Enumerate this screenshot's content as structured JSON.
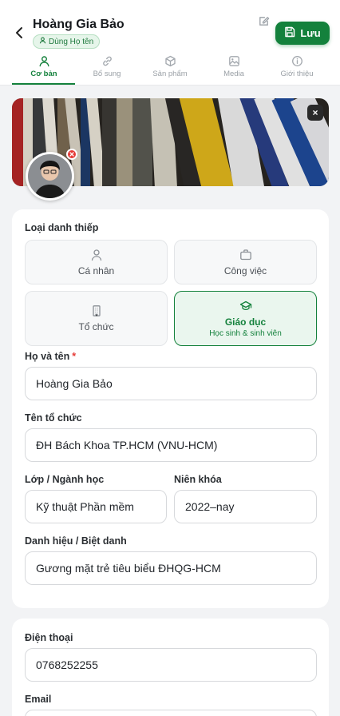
{
  "header": {
    "name": "Hoàng Gia Bảo",
    "name_chip": "Dùng Họ tên",
    "save_label": "Lưu"
  },
  "tabs": [
    {
      "label": "Cơ bản",
      "icon": "user-icon",
      "active": true
    },
    {
      "label": "Bổ sung",
      "icon": "link-icon",
      "active": false
    },
    {
      "label": "Sản phẩm",
      "icon": "box-icon",
      "active": false
    },
    {
      "label": "Media",
      "icon": "image-icon",
      "active": false
    },
    {
      "label": "Giới thiệu",
      "icon": "info-icon",
      "active": false
    }
  ],
  "cover": {
    "close_label": "×"
  },
  "card_type": {
    "title": "Loại danh thiếp",
    "options": [
      {
        "label": "Cá nhân",
        "icon": "person-icon"
      },
      {
        "label": "Công việc",
        "icon": "briefcase-icon"
      },
      {
        "label": "Tổ chức",
        "icon": "building-icon"
      },
      {
        "label": "Giáo dục",
        "sub": "Học sinh & sinh viên",
        "icon": "graduation-cap-icon",
        "selected": true
      }
    ]
  },
  "form": {
    "full_name_label": "Họ và tên",
    "required_mark": "*",
    "full_name_value": "Hoàng Gia Bảo",
    "org_label": "Tên tổ chức",
    "org_value": "ĐH Bách Khoa TP.HCM (VNU-HCM)",
    "class_label": "Lớp / Ngành học",
    "class_value": "Kỹ thuật Phần mềm",
    "year_label": "Niên khóa",
    "year_value": "2022–nay",
    "title_label": "Danh hiệu / Biệt danh",
    "title_value": "Gương mặt trẻ tiêu biểu ĐHQG-HCM"
  },
  "contact": {
    "phone_label": "Điện thoại",
    "phone_value": "0768252255",
    "email_label": "Email"
  },
  "colors": {
    "accent": "#14813c",
    "accent_light": "#eaf6ee",
    "danger": "#e53935"
  }
}
